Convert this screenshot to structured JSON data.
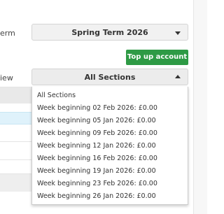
{
  "term": {
    "label": "erm",
    "selected": "Spring Term 2026"
  },
  "topup": {
    "label": "Top up account"
  },
  "view": {
    "label": "iew",
    "selected": "All Sections",
    "options": [
      "All Sections",
      "Week beginning 02 Feb 2026: £0.00",
      "Week beginning 05 Jan 2026: £0.00",
      "Week beginning 09 Feb 2026: £0.00",
      "Week beginning 12 Jan 2026: £0.00",
      "Week beginning 16 Feb 2026: £0.00",
      "Week beginning 19 Jan 2026: £0.00",
      "Week beginning 23 Feb 2026: £0.00",
      "Week beginning 26 Jan 2026: £0.00"
    ]
  },
  "colors": {
    "accent_green": "#2e9a45",
    "row_highlight": "#dff2fb"
  }
}
